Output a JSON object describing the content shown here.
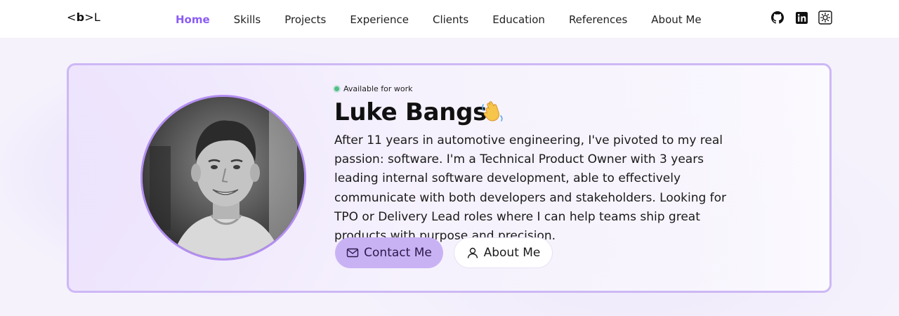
{
  "logo": {
    "left": "<",
    "bold": "b",
    "right": ">L"
  },
  "nav": {
    "items": [
      {
        "label": "Home",
        "active": true
      },
      {
        "label": "Skills"
      },
      {
        "label": "Projects"
      },
      {
        "label": "Experience"
      },
      {
        "label": "Clients"
      },
      {
        "label": "Education"
      },
      {
        "label": "References"
      },
      {
        "label": "About Me"
      }
    ],
    "social_icons": [
      "github-icon",
      "linkedin-icon",
      "theme-toggle-icon"
    ]
  },
  "hero": {
    "status": "Available for work",
    "name": "Luke Bangs",
    "wave_emoji_icon": "waving-hand-icon",
    "bio": "After 11 years in automotive engineering, I've pivoted to my real passion: software. I'm a Technical Product Owner with 3 years leading internal software development, able to effectively communicate with both developers and stakeholders. Looking for TPO or Delivery Lead roles where I can help teams ship great products with purpose and precision.",
    "buttons": {
      "contact": {
        "label": "Contact Me",
        "icon": "mail-icon"
      },
      "about": {
        "label": "About Me",
        "icon": "user-icon"
      }
    }
  },
  "colors": {
    "accent": "#8b5cf6",
    "card_border": "#cdb8f5",
    "contact_button": "#c9b2f4",
    "status_dot": "#4fbf86"
  }
}
